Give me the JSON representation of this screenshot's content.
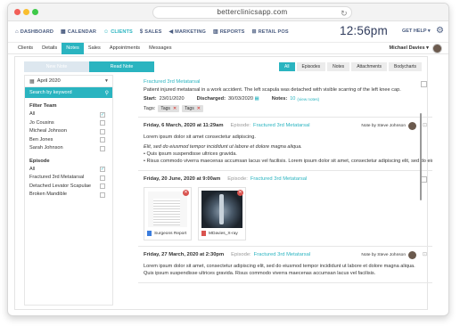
{
  "browser": {
    "url": "betterclinicsapp.com"
  },
  "topnav": {
    "items": [
      {
        "label": "DASHBOARD",
        "icon": "home-icon"
      },
      {
        "label": "CALENDAR",
        "icon": "calendar-icon"
      },
      {
        "label": "CLIENTS",
        "icon": "users-icon",
        "active": true
      },
      {
        "label": "SALES",
        "icon": "dollar-icon"
      },
      {
        "label": "MARKETING",
        "icon": "megaphone-icon"
      },
      {
        "label": "REPORTS",
        "icon": "chart-icon"
      },
      {
        "label": "RETAIL POS",
        "icon": "cart-icon"
      }
    ],
    "time": "12:56pm",
    "help": "GET HELP ▾"
  },
  "subnav": {
    "tabs": [
      "Clients",
      "Details",
      "Notes",
      "Sales",
      "Appointments",
      "Messages"
    ],
    "active": "Notes",
    "user": "Michael Davies ▾"
  },
  "notes_switch": {
    "new": "New Note",
    "read": "Read Note"
  },
  "filter_tabs": [
    "All",
    "Episodes",
    "Notes",
    "Attachments",
    "Bodycharts"
  ],
  "sidebar": {
    "month": "April 2020",
    "search_placeholder": "Search by keyword",
    "team_title": "Filter Team",
    "team": [
      {
        "label": "All",
        "checked": true
      },
      {
        "label": "Jo Cousins",
        "checked": false
      },
      {
        "label": "Micheal Johnson",
        "checked": false
      },
      {
        "label": "Ben Jones",
        "checked": false
      },
      {
        "label": "Sarah Johnson",
        "checked": false
      }
    ],
    "episode_title": "Episode",
    "episodes": [
      {
        "label": "All",
        "checked": true
      },
      {
        "label": "Fractured 3rd Metatarsal",
        "checked": false
      },
      {
        "label": "Detached Levator Scapulae",
        "checked": false
      },
      {
        "label": "Broken Mandible",
        "checked": false
      }
    ]
  },
  "episode_card": {
    "title": "Fractured 3rd Metatarsal",
    "description": "Patient injured metatarsal in a work accident. The left scapula was detached with visible scarring of the left knee cap.",
    "start_label": "Start:",
    "start": "23/01/2020",
    "discharged_label": "Discharged:",
    "discharged": "30/03/2020",
    "notes_label": "Notes:",
    "notes_count": "10",
    "view_notes": "(view notes)",
    "tags_label": "Tags:",
    "tags": [
      "Tags",
      "Tags"
    ]
  },
  "notes": [
    {
      "date": "Friday, 6 March, 2020 at 11:29am",
      "episode_label": "Episode:",
      "episode": "Fractured 3rd Metatarsal",
      "by": "Note by Steve Johnson",
      "line1": "Lorem ipsum dolor sit amet consectetur adipiscing.",
      "italic": "Elit, sed do eiusmod tempor incididunt ut labore et dolore magna aliqua.",
      "bullet1": "• Quis ipsum suspendisse ultrices gravida.",
      "bullet2": "• Risus commodo viverra maecenas accumsan lacus vel facilisis.  Lorem ipsum dolor sit amet, consectetur adipiscing elit, sed do eius"
    },
    {
      "date": "Friday, 20 June, 2020 at 9:00am",
      "episode_label": "Episode:",
      "episode": "Fractured 3rd Metatarsal",
      "files": [
        {
          "name": "Surgeons Report",
          "type": "doc-icon"
        },
        {
          "name": "MDavies_X-ray",
          "type": "pdf-icon"
        }
      ]
    },
    {
      "date": "Friday, 27 March, 2020 at 2:30pm",
      "episode_label": "Episode:",
      "episode": "Fractured 3rd Metatarsal",
      "by": "Note by Steve Johnson",
      "line1": "Lorem ipsum dolor sit amet, consectetur adipiscing elit, sed do eiusmod tempor incididunt ut labore et dolore magna aliqua.",
      "line2": "Quis ipsum suspendisse ultrices gravida.  Risus commodo viverra maecenas accumsan lacus vel facilisis."
    }
  ],
  "colors": {
    "accent": "#2ab4c0",
    "nav_text": "#4a5c80",
    "delete": "#d9534f"
  }
}
